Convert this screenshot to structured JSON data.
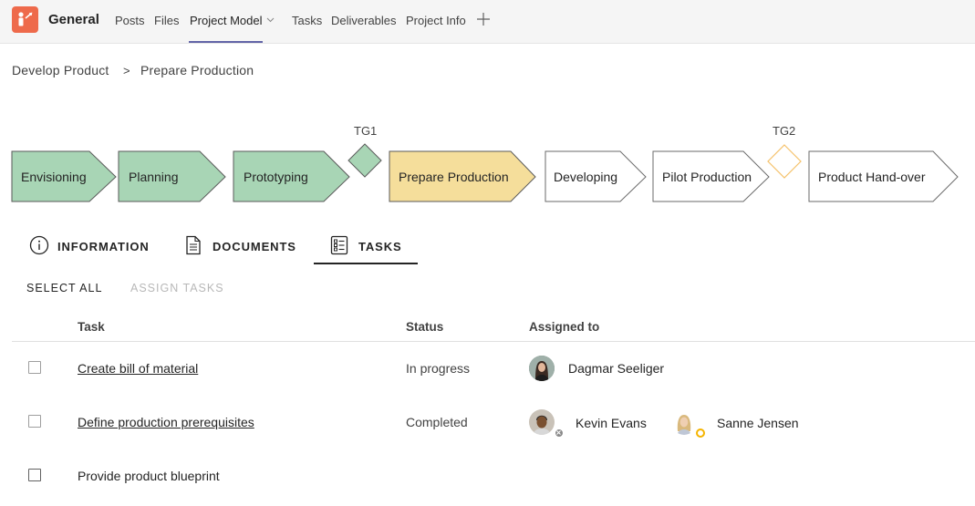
{
  "header": {
    "channel_title": "General",
    "tabs": [
      {
        "label": "Posts"
      },
      {
        "label": "Files"
      },
      {
        "label": "Project Model"
      },
      {
        "label": "Tasks"
      },
      {
        "label": "Deliverables"
      },
      {
        "label": "Project Info"
      }
    ],
    "active_tab": "Project Model",
    "accent_color": "#6264a7",
    "app_icon_color": "#ee6a4b"
  },
  "breadcrumb": {
    "items": [
      "Develop Product",
      "Prepare Production"
    ],
    "separator": ">"
  },
  "process": {
    "phases": [
      {
        "label": "Envisioning",
        "state": "completed"
      },
      {
        "label": "Planning",
        "state": "completed"
      },
      {
        "label": "Prototyping",
        "state": "completed"
      },
      {
        "label": "Prepare Production",
        "state": "current"
      },
      {
        "label": "Developing",
        "state": "upcoming"
      },
      {
        "label": "Pilot Production",
        "state": "upcoming"
      },
      {
        "label": "Product Hand-over",
        "state": "upcoming"
      }
    ],
    "gates": [
      {
        "label": "TG1",
        "state": "passed"
      },
      {
        "label": "TG2",
        "state": "pending"
      }
    ],
    "colors": {
      "completed_fill": "#a8d5b5",
      "current_fill": "#f5de9b",
      "upcoming_fill": "#ffffff",
      "pending_gate_stroke": "#f5c26b"
    }
  },
  "detail_tabs": {
    "items": [
      {
        "label": "INFORMATION",
        "icon": "info-icon"
      },
      {
        "label": "DOCUMENTS",
        "icon": "document-icon"
      },
      {
        "label": "TASKS",
        "icon": "checklist-icon"
      }
    ],
    "active": "TASKS"
  },
  "actions": {
    "select_all": "SELECT ALL",
    "assign_tasks": "ASSIGN TASKS"
  },
  "table": {
    "columns": [
      "Task",
      "Status",
      "Assigned to"
    ],
    "rows": [
      {
        "task": "Create bill of material",
        "status": "In progress",
        "assignees": [
          {
            "name": "Dagmar Seeliger",
            "presence": "none"
          }
        ]
      },
      {
        "task": "Define production prerequisites",
        "status": "Completed",
        "assignees": [
          {
            "name": "Kevin Evans",
            "presence": "offline"
          },
          {
            "name": "Sanne Jensen",
            "presence": "away"
          }
        ]
      },
      {
        "task": "Provide product blueprint",
        "status": "",
        "assignees": []
      }
    ]
  }
}
